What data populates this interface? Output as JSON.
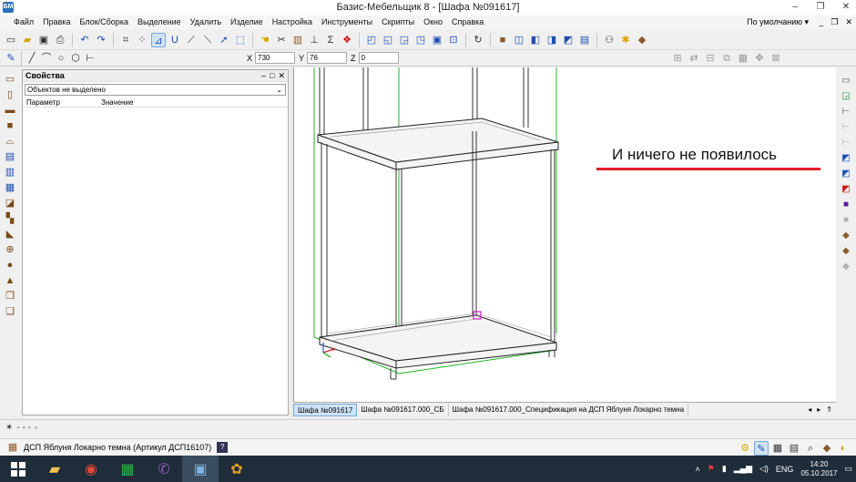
{
  "window": {
    "title": "Базис-Мебельщик 8 - [Шафа №091617]",
    "app_icon_text": "БМ",
    "minimize": "–",
    "maximize": "❐",
    "close": "✕"
  },
  "menu": {
    "items": [
      "Файл",
      "Правка",
      "Блок/Сборка",
      "Выделение",
      "Удалить",
      "Изделие",
      "Настройка",
      "Инструменты",
      "Скрипты",
      "Окно",
      "Справка"
    ],
    "profile": "По умолчанию ▾",
    "mdi_min": "_",
    "mdi_restore": "❐",
    "mdi_close": "✕"
  },
  "coords": {
    "x_label": "X",
    "x_value": "730",
    "y_label": "Y",
    "y_value": "76",
    "z_label": "Z",
    "z_value": "0"
  },
  "properties": {
    "title": "Свойства",
    "pin": "–",
    "float": "□",
    "close": "✕",
    "selector_value": "Объектов не выделено",
    "col_param": "Параметр",
    "col_value": "Значение"
  },
  "annotation": {
    "text": "И ничего не появилось",
    "color": "#e0202a"
  },
  "tabs": {
    "items": [
      "Шафа №091617",
      "Шафа №091617.000_СБ",
      "Шафа №091617.000_Спецификация на ДСП Яблуня Локарно темна"
    ],
    "active_index": 0,
    "nav_prev": "◂",
    "nav_next": "▸",
    "nav_up": "⇑"
  },
  "status": {
    "material": "ДСП Яблуня Локарно темна (Артикул ДСП16107)",
    "help": "?"
  },
  "tray": {
    "language": "ENG",
    "time": "14:20",
    "date": "05.10.2017"
  },
  "colors": {
    "accent": "#1d4fb3",
    "taskbar": "#1f2c3a",
    "underline": "#e0202a"
  }
}
